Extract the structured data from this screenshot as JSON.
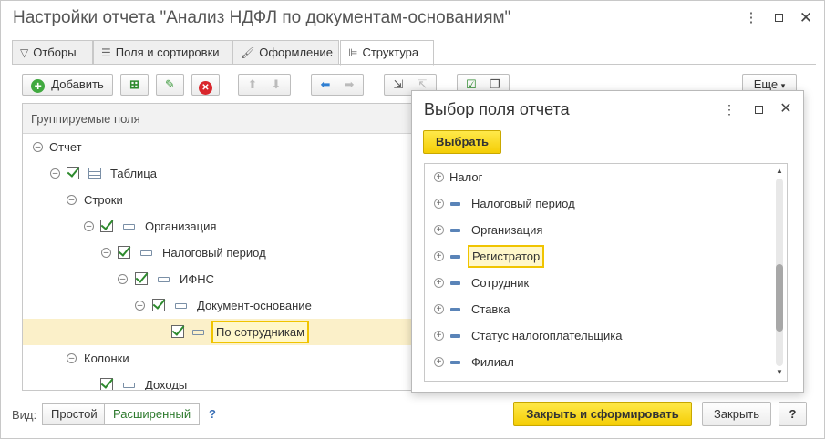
{
  "window": {
    "title": "Настройки отчета \"Анализ НДФЛ по документам-основаниям\""
  },
  "tabs": [
    {
      "label": "Отборы",
      "icon": "filter-icon"
    },
    {
      "label": "Поля и сортировки",
      "icon": "fields-icon"
    },
    {
      "label": "Оформление",
      "icon": "brush-icon"
    },
    {
      "label": "Структура",
      "icon": "structure-icon",
      "active": true
    }
  ],
  "toolbar": {
    "add_label": "Добавить",
    "more_label": "Еще"
  },
  "tree": {
    "header": "Группируемые поля",
    "rows": [
      {
        "label": "Отчет"
      },
      {
        "label": "Таблица"
      },
      {
        "label": "Строки"
      },
      {
        "label": "Организация"
      },
      {
        "label": "Налоговый период"
      },
      {
        "label": "ИФНС"
      },
      {
        "label": "Документ-основание"
      },
      {
        "label": "По сотрудникам",
        "selected": true
      },
      {
        "label": "Колонки"
      },
      {
        "label": "Доходы"
      }
    ]
  },
  "bottom": {
    "view_label": "Вид:",
    "simple_label": "Простой",
    "advanced_label": "Расширенный",
    "help_label": "?",
    "close_generate_label": "Закрыть и сформировать",
    "close_label": "Закрыть",
    "help_btn_label": "?"
  },
  "popup": {
    "title": "Выбор поля отчета",
    "select_label": "Выбрать",
    "items": [
      {
        "label": "Налог"
      },
      {
        "label": "Налоговый период"
      },
      {
        "label": "Организация"
      },
      {
        "label": "Регистратор",
        "selected": true
      },
      {
        "label": "Сотрудник"
      },
      {
        "label": "Ставка"
      },
      {
        "label": "Статус налогоплательщика"
      },
      {
        "label": "Филиал"
      }
    ]
  },
  "colors": {
    "accent_yellow": "#f4cd05",
    "check_green": "#2d8a2d",
    "selection": "#fbf0c9"
  }
}
